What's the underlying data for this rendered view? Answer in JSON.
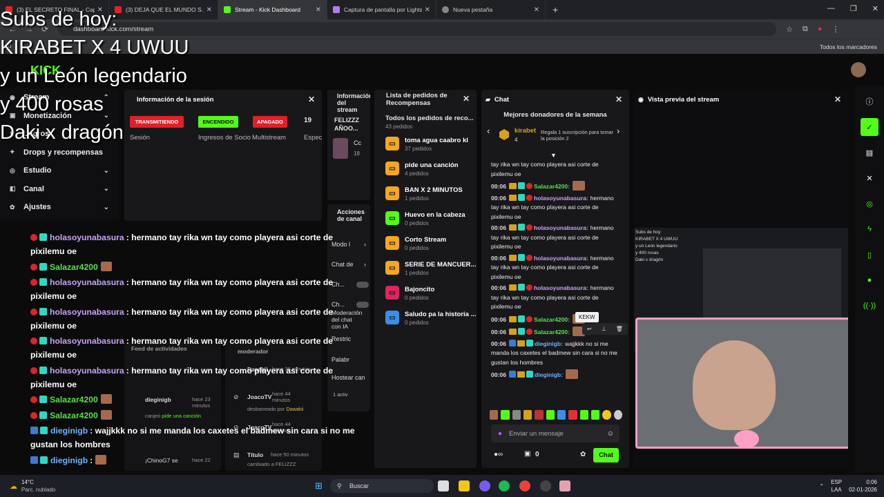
{
  "overlay": {
    "lines": [
      "Subs de hoy:",
      "KIRABET X 4 UWUU",
      "y un León legendario",
      "y 400 rosas",
      "Daki x dragón"
    ]
  },
  "browser": {
    "tabs": [
      {
        "title": "(3) EL SECRETO FINAL - Capi",
        "active": false
      },
      {
        "title": "(3) DEJA QUE EL MUNDO S...",
        "active": false
      },
      {
        "title": "Stream - Kick Dashboard",
        "active": true
      },
      {
        "title": "Captura de pantalla por Lightsh...",
        "active": false
      },
      {
        "title": "Nueva pestaña",
        "active": false
      }
    ],
    "url": "dashboard.kick.com/stream",
    "bookmarks_label": "Todos los marcadores"
  },
  "sidebar": {
    "items": [
      {
        "label": "Stream",
        "icon": "stream-icon"
      },
      {
        "label": "Monetización",
        "icon": "money-icon"
      },
      {
        "label": "Logros",
        "icon": "trophy-icon"
      },
      {
        "label": "Drops y recompensas",
        "icon": "gift-icon"
      },
      {
        "label": "Estudio",
        "icon": "studio-icon"
      },
      {
        "label": "Canal",
        "icon": "channel-icon"
      },
      {
        "label": "Ajustes",
        "icon": "gear-icon"
      }
    ]
  },
  "session": {
    "title": "Información de la sesión",
    "badges": [
      "TRANSMITIENDO",
      "ENCENDIDO",
      "APAGADO",
      "19"
    ],
    "labels": [
      "Sesión",
      "Ingresos de Socio",
      "Multistream",
      "Espec"
    ]
  },
  "stream_info": {
    "title": "Información del stream",
    "name": "FELIZZZ AÑOO...",
    "sub": "Cc",
    "count": "18"
  },
  "actions": {
    "title": "Acciones de canal",
    "items": [
      "Modo l",
      "Chat de",
      "Ch...",
      "Ch...",
      "Moderación del chat con IA",
      "Restric",
      "Palabr",
      "Hostear can",
      "1 activ"
    ]
  },
  "activity": {
    "title": "Feed de actividades",
    "items": [
      {
        "user": "dieginigb",
        "time": "hace 23 minutos",
        "text": "canjeó",
        "link": "pide una canción"
      },
      {
        "user": "¡ChinoG7 se",
        "time": "hace 22"
      }
    ]
  },
  "moderator": {
    "title": "moderador",
    "items": [
      {
        "user": "Daaakii",
        "time": "hace 39 minutos"
      },
      {
        "user": "JoacoTV",
        "time": "hace 44 minutos",
        "text": "desbaneado por",
        "by": "Daaakii"
      },
      {
        "user": "JoacoTV",
        "time": "hace 44 minutos"
      },
      {
        "user": "Título",
        "time": "hace 50 minutos",
        "text": "cambiado a FELIZZZ"
      }
    ]
  },
  "requests": {
    "title": "Lista de pedidos de Recompensas",
    "subtitle": "Todos los pedidos de reco...",
    "count": "43 pedidos",
    "items": [
      {
        "title": "toma agua caabro kl",
        "sub": "37 pedidos",
        "color": "#f5a623"
      },
      {
        "title": "pide una canción",
        "sub": "4 pedidos",
        "color": "#f5a623"
      },
      {
        "title": "BAN X 2 MINUTOS",
        "sub": "1 pedidos",
        "color": "#f5a623"
      },
      {
        "title": "Huevo en la cabeza",
        "sub": "0 pedidos",
        "color": "#53fc18"
      },
      {
        "title": "Corto Stream",
        "sub": "0 pedidos",
        "color": "#f5a623"
      },
      {
        "title": "SERIE DE MANCUER...",
        "sub": "1 pedidos",
        "color": "#f5a623"
      },
      {
        "title": "Bajoncito",
        "sub": "0 pedidos",
        "color": "#e0245e"
      },
      {
        "title": "Saludo pa la historia ...",
        "sub": "0 pedidos",
        "color": "#3a8ee6"
      }
    ]
  },
  "chat": {
    "title": "Chat",
    "donors_title": "Mejores donadores de la semana",
    "donor_name": "kirabet",
    "donor_count": "4",
    "donor_cta": "Regala 1 suscripción para tomar la posición 2",
    "tooltip": "KEKW",
    "input_placeholder": "Enviar un mensaje",
    "points": "0",
    "send": "Chat",
    "messages": [
      {
        "time": "",
        "user": "",
        "text": "tay rika wn tay como playera asi corte de pixilemu oe"
      },
      {
        "time": "00:06",
        "user": "Salazar4200:",
        "text": "",
        "kind": "green"
      },
      {
        "time": "00:06",
        "user": "holasoyunabasura:",
        "text": "hermano tay rika wn tay como playera asi corte de pixilemu oe",
        "kind": "purple"
      },
      {
        "time": "00:06",
        "user": "holasoyunabasura:",
        "text": "hermano tay rika wn tay como playera asi corte de pixilemu oe",
        "kind": "purple"
      },
      {
        "time": "00:06",
        "user": "holasoyunabasura:",
        "text": "hermano tay rika wn tay como playera asi corte de pixilemu oe",
        "kind": "purple"
      },
      {
        "time": "00:06",
        "user": "holasoyunabasura:",
        "text": "hermano tay rika wn tay como playera asi corte de pixilemu oe",
        "kind": "purple"
      },
      {
        "time": "00:06",
        "user": "Salazar4200:",
        "text": "",
        "kind": "green"
      },
      {
        "time": "00:06",
        "user": "Salazar4200:",
        "text": "",
        "kind": "green"
      },
      {
        "time": "00:06",
        "user": "dieginigb:",
        "text": "wajjkkk no si me manda los caxetes el badmew sin cara si no me gustan los hombres",
        "kind": "blue"
      },
      {
        "time": "00:06",
        "user": "dieginigb:",
        "text": "",
        "kind": "blue"
      }
    ]
  },
  "preview": {
    "title": "Vista previa del stream"
  },
  "left_chat": [
    {
      "user": "holasoyunabasura",
      "text": ": hermano tay rika wn tay como playera asi corte de pixilemu oe",
      "kind": "purple"
    },
    {
      "user": "Salazar4200",
      "text": "",
      "kind": "green"
    },
    {
      "user": "holasoyunabasura",
      "text": ": hermano tay rika wn tay como playera asi corte de pixilemu oe",
      "kind": "purple"
    },
    {
      "user": "holasoyunabasura",
      "text": ": hermano tay rika wn tay como playera asi corte de pixilemu oe",
      "kind": "purple"
    },
    {
      "user": "holasoyunabasura",
      "text": ": hermano tay rika wn tay como playera asi corte de pixilemu oe",
      "kind": "purple"
    },
    {
      "user": "holasoyunabasura",
      "text": ": hermano tay rika wn tay como playera asi corte de pixilemu oe",
      "kind": "purple"
    },
    {
      "user": "Salazar4200",
      "text": "",
      "kind": "green"
    },
    {
      "user": "Salazar4200",
      "text": "",
      "kind": "green"
    },
    {
      "user": "dieginigb",
      "text": ": wajjkkk no si me manda los caxetes el badmew sin cara si no me gustan los hombres",
      "kind": "blue"
    },
    {
      "user": "dieginigb",
      "text": ":",
      "kind": "blue"
    }
  ],
  "taskbar": {
    "weather_temp": "14°C",
    "weather_desc": "Parc. nublado",
    "search": "Buscar",
    "lang": "ESP",
    "lang_sub": "LAA",
    "time": "0:06",
    "date": "02-01-2026"
  },
  "colors": {
    "kick_green": "#53fc18",
    "live_red": "#e0202a",
    "panel": "#18181b"
  }
}
